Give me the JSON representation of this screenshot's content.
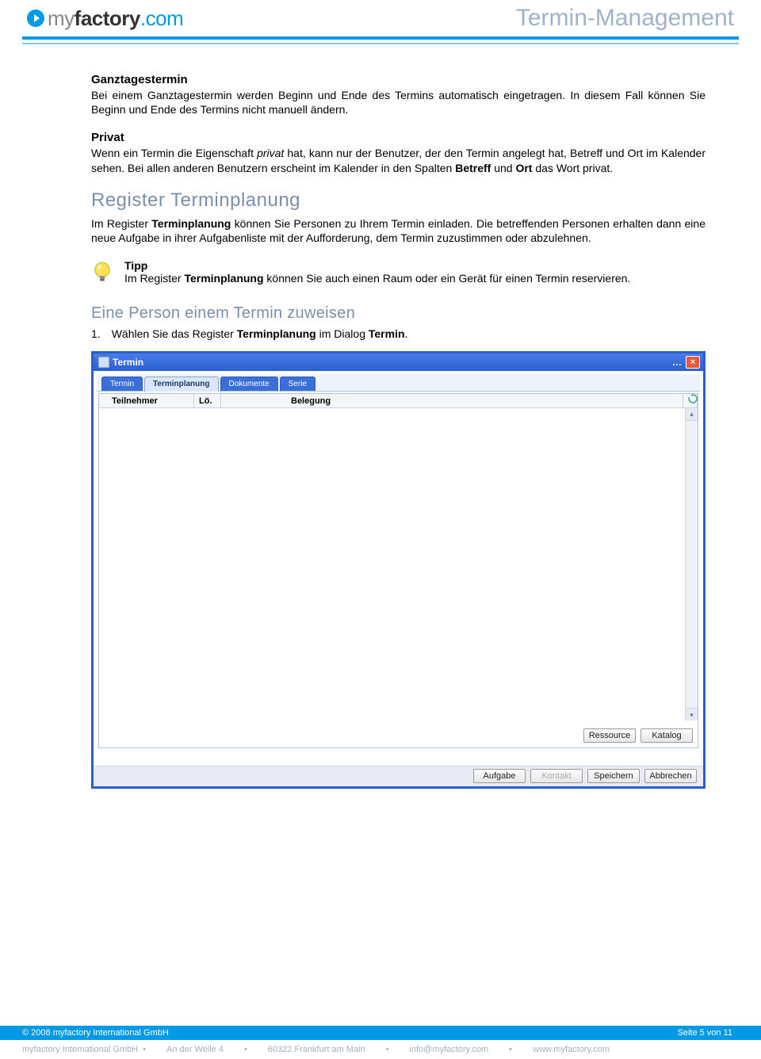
{
  "header": {
    "logo_my": "my",
    "logo_factory": "factory",
    "logo_dotcom": ".com",
    "title": "Termin-Management"
  },
  "section1": {
    "heading": "Ganztagestermin",
    "text": "Bei einem Ganztagestermin werden Beginn und Ende des Termins automatisch eingetragen. In diesem Fall können Sie Beginn und Ende des Termins nicht manuell ändern."
  },
  "section2": {
    "heading": "Privat",
    "t1": "Wenn ein Termin die Eigenschaft ",
    "em": "privat",
    "t2": " hat, kann nur der Benutzer, der den Termin angelegt hat, Betreff und Ort im Kalender sehen. Bei allen anderen Benutzern erscheint im Kalender in den Spalten ",
    "b1": "Betreff",
    "t3": " und ",
    "b2": "Ort",
    "t4": " das Wort privat."
  },
  "section3": {
    "heading": "Register Terminplanung",
    "t1": "Im Register ",
    "b1": "Terminplanung",
    "t2": " können Sie Personen zu Ihrem Termin einladen. Die betreffenden Personen erhalten dann eine neue Aufgabe in ihrer Aufgabenliste mit der Aufforderung, dem Termin zuzustimmen oder abzulehnen."
  },
  "tip": {
    "title": "Tipp",
    "t1": "Im Register ",
    "b1": "Terminplanung",
    "t2": " können Sie auch einen Raum oder ein Gerät für einen Termin reservieren."
  },
  "section4": {
    "heading": "Eine Person einem Termin zuweisen",
    "num": "1.",
    "t1": "Wählen Sie das Register ",
    "b1": "Terminplanung",
    "t2": " im Dialog ",
    "b2": "Termin",
    "t3": "."
  },
  "dialog": {
    "title": "Termin",
    "tabs": [
      "Termin",
      "Terminplanung",
      "Dokumente",
      "Serie"
    ],
    "active_tab_index": 1,
    "columns": {
      "c1": "Teilnehmer",
      "c2": "Lö.",
      "c3": "",
      "c4": "Belegung"
    },
    "buttons_row1": [
      "Ressource",
      "Katalog"
    ],
    "buttons_row2": [
      "Aufgabe",
      "Kontakt",
      "Speichern",
      "Abbrechen"
    ],
    "disabled_row2_index": 1
  },
  "footer": {
    "copyright": "© 2008 myfactory International GmbH",
    "page": "Seite 5 von 11",
    "company": "myfactory International GmbH",
    "addr1": "An der Welle 4",
    "addr2": "60322 Frankfurt am Main",
    "email": "info@myfactory.com",
    "web": "www.myfactory.com",
    "sep": "•"
  }
}
